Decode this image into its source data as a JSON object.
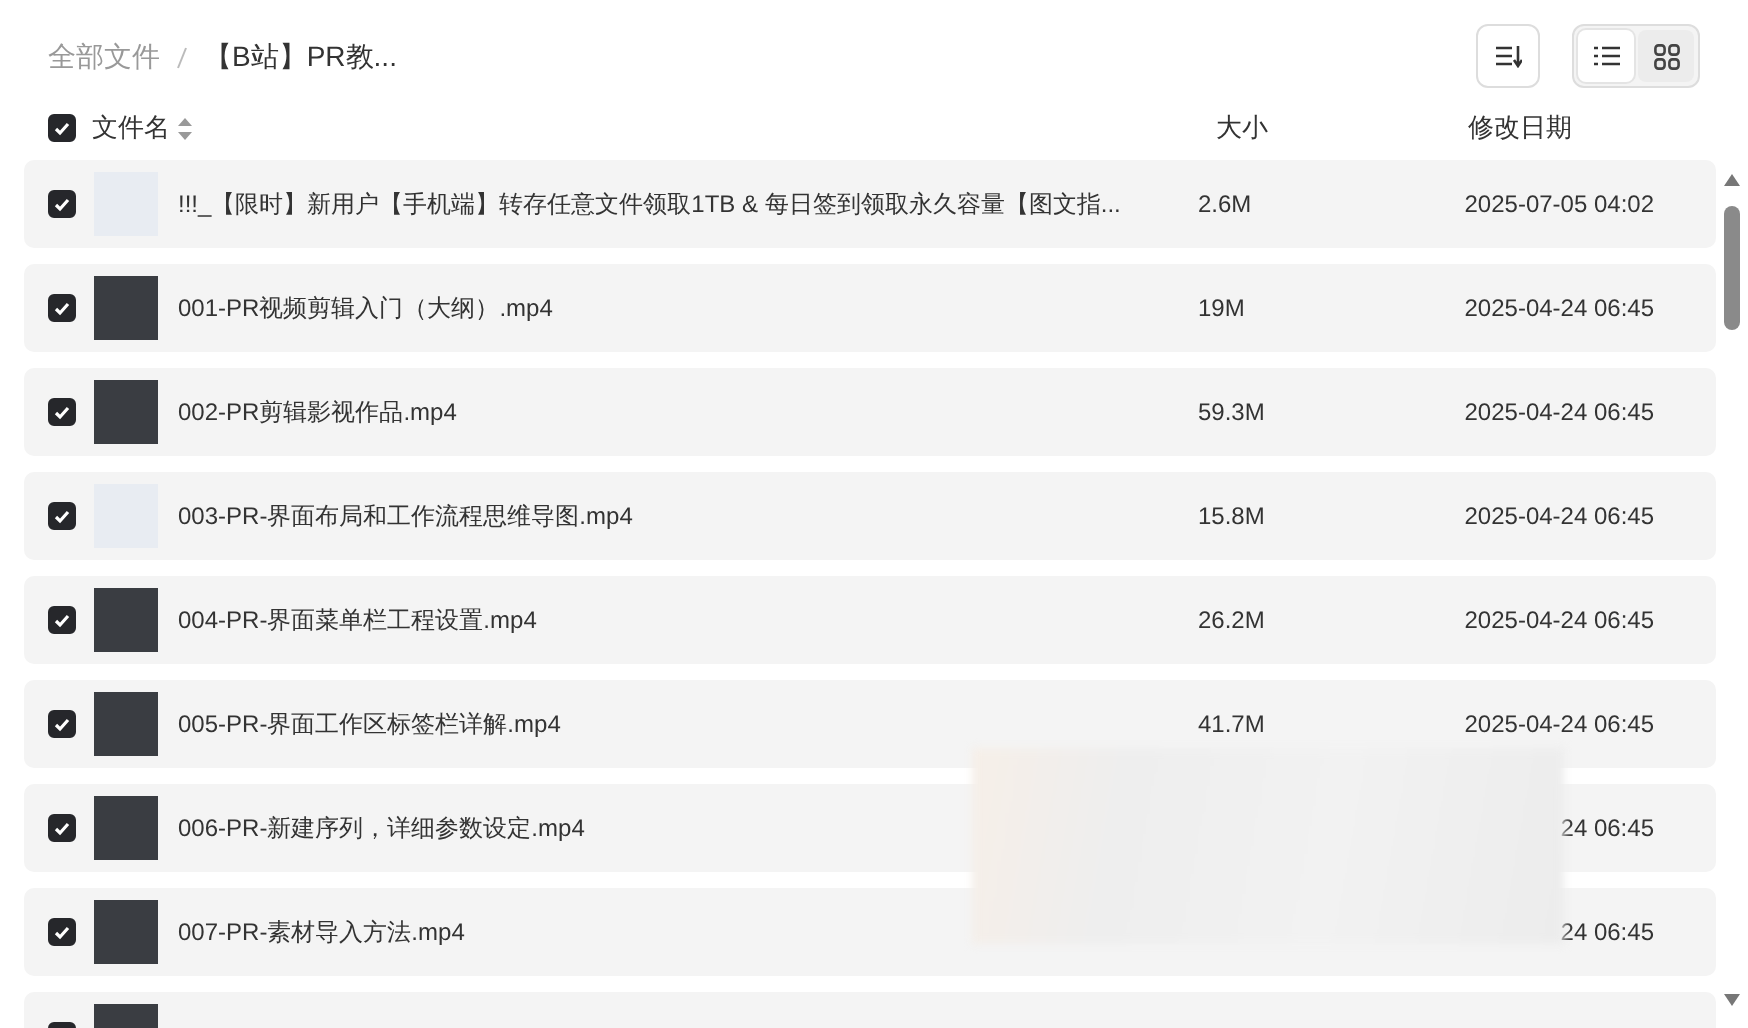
{
  "breadcrumb": [
    {
      "label": "全部文件",
      "current": false
    },
    {
      "label": "【B站】PR教...",
      "current": true
    }
  ],
  "view_modes": [
    {
      "kind": "list",
      "selected": true
    },
    {
      "kind": "grid",
      "selected": false
    }
  ],
  "header": {
    "checked": true,
    "columns": [
      "文件名",
      "大小",
      "修改日期"
    ]
  },
  "rows": [
    {
      "checked": true,
      "name": "!!!_【限时】新用户【手机端】转存任意文件领取1TB & 每日签到领取永久容量【图文指...",
      "size": "2.6M",
      "date": "2025-07-05 04:02"
    },
    {
      "checked": true,
      "name": "001-PR视频剪辑入门（大纲）.mp4",
      "size": "19M",
      "date": "2025-04-24 06:45"
    },
    {
      "checked": true,
      "name": "002-PR剪辑影视作品.mp4",
      "size": "59.3M",
      "date": "2025-04-24 06:45"
    },
    {
      "checked": true,
      "name": "003-PR-界面布局和工作流程思维导图.mp4",
      "size": "15.8M",
      "date": "2025-04-24 06:45"
    },
    {
      "checked": true,
      "name": "004-PR-界面菜单栏工程设置.mp4",
      "size": "26.2M",
      "date": "2025-04-24 06:45"
    },
    {
      "checked": true,
      "name": "005-PR-界面工作区标签栏详解.mp4",
      "size": "41.7M",
      "date": "2025-04-24 06:45"
    },
    {
      "checked": true,
      "name": "006-PR-新建序列，详细参数设定.mp4",
      "date": "24 06:45"
    },
    {
      "checked": true,
      "name": "007-PR-素材导入方法.mp4",
      "date": "24 06:45"
    },
    {
      "checked": true
    }
  ]
}
